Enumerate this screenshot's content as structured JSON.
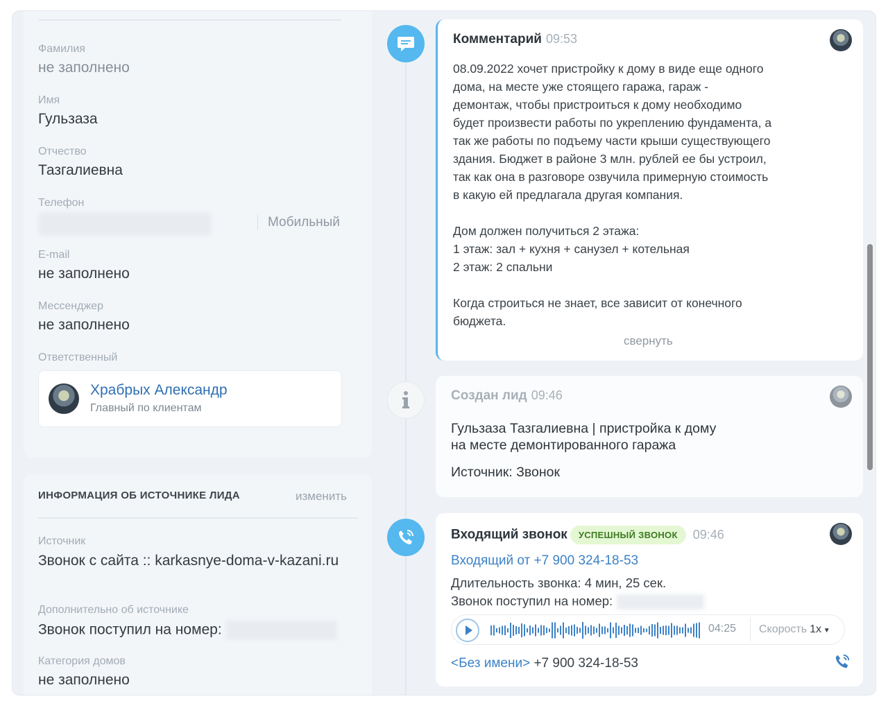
{
  "contact": {
    "last_name_label": "Фамилия",
    "last_name_value": "не заполнено",
    "first_name_label": "Имя",
    "first_name_value": "Гульзаза",
    "patronymic_label": "Отчество",
    "patronymic_value": "Тазгалиевна",
    "phone_label": "Телефон",
    "phone_type": "Мобильный",
    "email_label": "E-mail",
    "email_value": "не заполнено",
    "messenger_label": "Мессенджер",
    "messenger_value": "не заполнено",
    "responsible_label": "Ответственный",
    "responsible_name": "Храбрых Александр",
    "responsible_role": "Главный по клиентам"
  },
  "source_info": {
    "title": "ИНФОРМАЦИЯ ОБ ИСТОЧНИКЕ ЛИДА",
    "edit_label": "изменить",
    "source_label": "Источник",
    "source_value": "Звонок с сайта :: karkasnye-doma-v-kazani.ru",
    "extra_label": "Дополнительно об источнике",
    "extra_value": "Звонок поступил на номер:",
    "category_label": "Категория домов",
    "category_value": "не заполнено"
  },
  "timeline": {
    "comment": {
      "title": "Комментарий",
      "time": "09:53",
      "text": "08.09.2022 хочет пристройку к дому в виде еще одного\nдома, на месте уже стоящего гаража, гараж -\nдемонтаж, чтобы пристроиться к дому необходимо\nбудет произвести работы по укреплению фундамента, а\nтак же работы по подъему части крыши существующего\nздания. Бюджет в районе 3 млн. рублей ее бы устроил,\nтак как она в разговоре озвучила примерную стоимость\nв какую ей предлагала другая компания.\n\nДом должен получиться 2 этажа:\n1 этаж: зал + кухня + санузел + котельная\n2 этаж: 2 спальни\n\nКогда строиться не знает, все зависит от конечного\nбюджета.",
      "collapse_label": "свернуть"
    },
    "lead": {
      "title": "Создан лид",
      "time": "09:46",
      "text": "Гульзаза Тазгалиевна | пристройка к дому\nна месте демонтированного гаража",
      "source": "Источник: Звонок"
    },
    "call": {
      "title": "Входящий звонок",
      "badge": "УСПЕШНЫЙ ЗВОНОК",
      "time": "09:46",
      "from": "Входящий от +7 900 324-18-53",
      "duration": "Длительность звонка: 4 мин, 25 сек.",
      "to_number": "Звонок поступил на номер:",
      "player_time": "04:25",
      "speed_label": "Скорость",
      "speed_value": "1x",
      "caller_name": "<Без имени>",
      "caller_phone": "+7 900 324-18-53"
    }
  },
  "colors": {
    "accent": "#3d82c6",
    "timeline_blue": "#55b8ee",
    "success_badge_bg": "#e4f7d3"
  }
}
